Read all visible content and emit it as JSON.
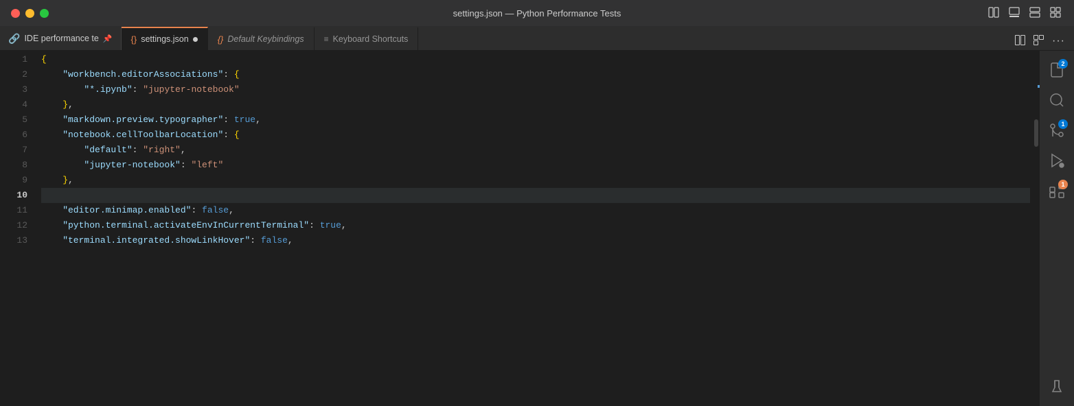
{
  "titlebar": {
    "title": "settings.json — Python Performance Tests",
    "traffic": [
      "close",
      "minimize",
      "maximize"
    ],
    "controls": [
      "split-editor-icon",
      "toggle-panel-icon",
      "split-view-icon",
      "layout-icon"
    ]
  },
  "tabs": [
    {
      "id": "explorer",
      "label": "IDE performance te",
      "icon": "explorer-icon",
      "active": false,
      "pinned": true,
      "type": "sidebar"
    },
    {
      "id": "settings-json",
      "label": "settings.json",
      "icon": "json-icon",
      "active": true,
      "modified": true,
      "type": "file"
    },
    {
      "id": "default-keybindings",
      "label": "Default Keybindings",
      "icon": "json-icon",
      "active": false,
      "italic": true,
      "type": "file"
    },
    {
      "id": "keyboard-shortcuts",
      "label": "Keyboard Shortcuts",
      "icon": "list-icon",
      "active": false,
      "type": "file"
    }
  ],
  "tabbar_actions": [
    {
      "id": "split-editor",
      "label": "⎘"
    },
    {
      "id": "toggle-layout",
      "label": "⊞"
    },
    {
      "id": "more",
      "label": "···"
    }
  ],
  "editor": {
    "lines": [
      {
        "num": 1,
        "bold": false,
        "content": [
          {
            "t": "plain",
            "v": "{"
          }
        ]
      },
      {
        "num": 2,
        "bold": false,
        "content": [
          {
            "t": "key",
            "v": "    \"workbench.editorAssociations\""
          },
          {
            "t": "colon",
            "v": ": "
          },
          {
            "t": "brace",
            "v": "{"
          }
        ]
      },
      {
        "num": 3,
        "bold": false,
        "content": [
          {
            "t": "key",
            "v": "        \"*.ipynb\""
          },
          {
            "t": "colon",
            "v": ": "
          },
          {
            "t": "string",
            "v": "\"jupyter-notebook\""
          }
        ]
      },
      {
        "num": 4,
        "bold": false,
        "content": [
          {
            "t": "plain",
            "v": "    "
          },
          {
            "t": "brace",
            "v": "}"
          },
          {
            "t": "comma",
            "v": ","
          }
        ]
      },
      {
        "num": 5,
        "bold": false,
        "content": [
          {
            "t": "key",
            "v": "    \"markdown.preview.typographer\""
          },
          {
            "t": "colon",
            "v": ": "
          },
          {
            "t": "bool",
            "v": "true"
          },
          {
            "t": "comma",
            "v": ","
          }
        ]
      },
      {
        "num": 6,
        "bold": false,
        "content": [
          {
            "t": "key",
            "v": "    \"notebook.cellToolbarLocation\""
          },
          {
            "t": "colon",
            "v": ": "
          },
          {
            "t": "brace",
            "v": "{"
          }
        ]
      },
      {
        "num": 7,
        "bold": false,
        "content": [
          {
            "t": "key",
            "v": "        \"default\""
          },
          {
            "t": "colon",
            "v": ": "
          },
          {
            "t": "string",
            "v": "\"right\""
          },
          {
            "t": "comma",
            "v": ","
          }
        ]
      },
      {
        "num": 8,
        "bold": false,
        "content": [
          {
            "t": "key",
            "v": "        \"jupyter-notebook\""
          },
          {
            "t": "colon",
            "v": ": "
          },
          {
            "t": "string",
            "v": "\"left\""
          }
        ]
      },
      {
        "num": 9,
        "bold": false,
        "content": [
          {
            "t": "plain",
            "v": "    "
          },
          {
            "t": "brace",
            "v": "}"
          },
          {
            "t": "comma",
            "v": ","
          }
        ]
      },
      {
        "num": 10,
        "bold": true,
        "content": [],
        "highlighted": true
      },
      {
        "num": 11,
        "bold": false,
        "content": [
          {
            "t": "key",
            "v": "    \"editor.minimap.enabled\""
          },
          {
            "t": "colon",
            "v": ": "
          },
          {
            "t": "bool",
            "v": "false"
          },
          {
            "t": "comma",
            "v": ","
          }
        ],
        "gutter": true
      },
      {
        "num": 12,
        "bold": false,
        "content": [
          {
            "t": "key",
            "v": "    \"python.terminal.activateEnvInCurrentTerminal\""
          },
          {
            "t": "colon",
            "v": ": "
          },
          {
            "t": "bool",
            "v": "true"
          },
          {
            "t": "comma",
            "v": ","
          }
        ]
      },
      {
        "num": 13,
        "bold": false,
        "content": [
          {
            "t": "key",
            "v": "    \"terminal.integrated.showLinkHover\""
          },
          {
            "t": "colon",
            "v": ": "
          },
          {
            "t": "bool",
            "v": "false"
          },
          {
            "t": "comma",
            "v": ","
          }
        ]
      }
    ]
  },
  "activity_bar": [
    {
      "id": "explorer-btn",
      "icon": "files-icon",
      "badge": null
    },
    {
      "id": "search-btn",
      "icon": "search-icon",
      "badge": null
    },
    {
      "id": "source-control-btn",
      "icon": "source-control-icon",
      "badge": "1",
      "badge_color": "badge-blue"
    },
    {
      "id": "run-debug-btn",
      "icon": "run-icon",
      "badge": null
    },
    {
      "id": "extensions-btn",
      "icon": "extensions-icon",
      "badge": "1",
      "badge_color": "badge-orange"
    },
    {
      "id": "test-btn",
      "icon": "test-icon",
      "badge": null
    }
  ]
}
